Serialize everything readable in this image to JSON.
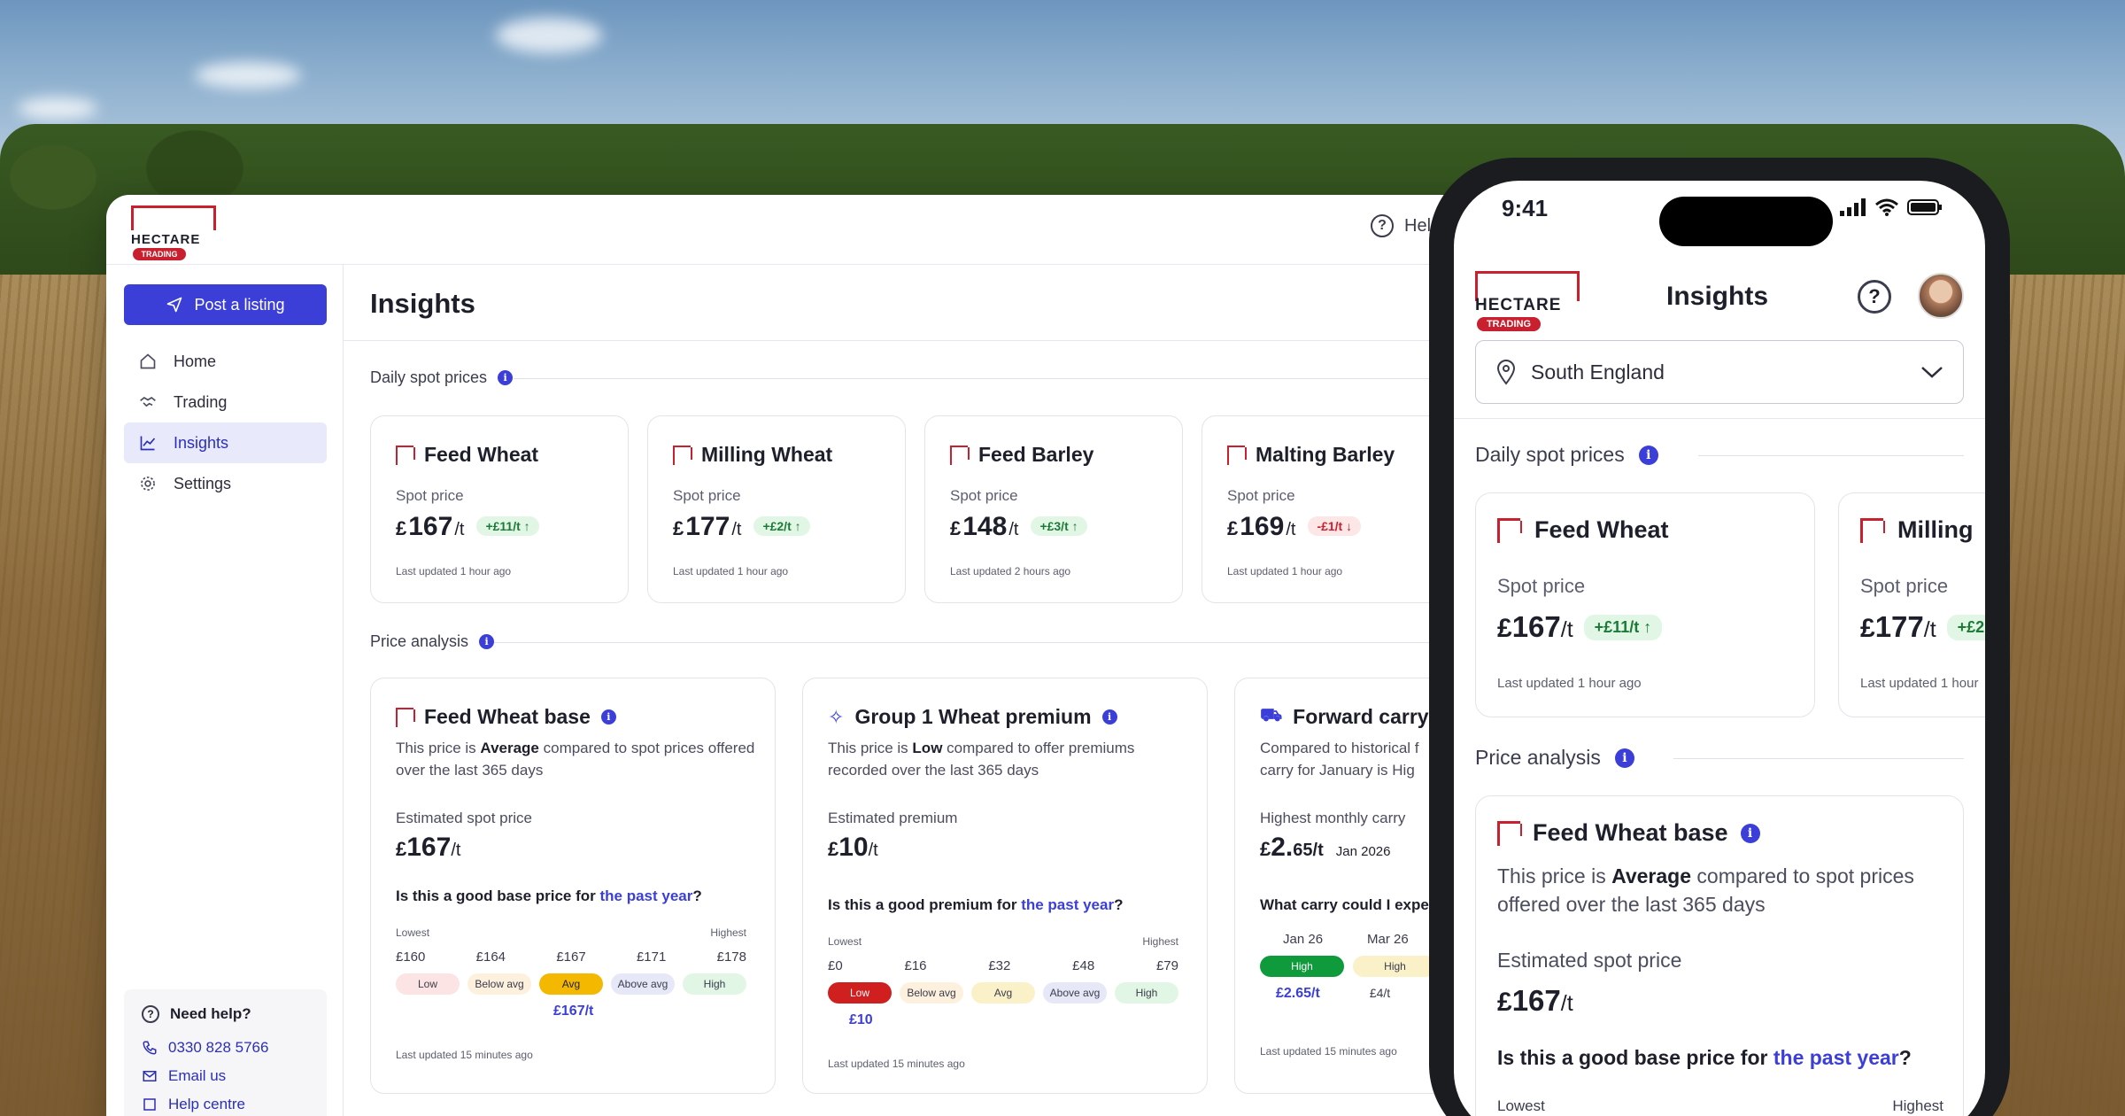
{
  "brand": {
    "word": "HECTARE",
    "tag": "TRADING"
  },
  "desktop": {
    "help_label": "Help",
    "post_button": "Post a listing",
    "nav": [
      {
        "label": "Home",
        "icon": "home-icon"
      },
      {
        "label": "Trading",
        "icon": "handshake-icon"
      },
      {
        "label": "Insights",
        "icon": "chart-icon",
        "active": true
      },
      {
        "label": "Settings",
        "icon": "gear-icon"
      }
    ],
    "help_box": {
      "title": "Need help?",
      "phone": "0330 828 5766",
      "email": "Email us",
      "centre": "Help centre"
    },
    "page_title": "Insights",
    "daily_label": "Daily spot prices",
    "analysis_label": "Price analysis",
    "spot_cards": [
      {
        "name": "Feed Wheat",
        "label": "Spot price",
        "currency": "£",
        "value": "167",
        "unit": "/t",
        "change": "+£11/t ↑",
        "direction": "up",
        "updated": "Last updated 1 hour ago"
      },
      {
        "name": "Milling Wheat",
        "label": "Spot price",
        "currency": "£",
        "value": "177",
        "unit": "/t",
        "change": "+£2/t ↑",
        "direction": "up",
        "updated": "Last updated 1 hour ago"
      },
      {
        "name": "Feed Barley",
        "label": "Spot price",
        "currency": "£",
        "value": "148",
        "unit": "/t",
        "change": "+£3/t ↑",
        "direction": "up",
        "updated": "Last updated 2 hours ago"
      },
      {
        "name": "Malting Barley",
        "label": "Spot price",
        "currency": "£",
        "value": "169",
        "unit": "/t",
        "change": "-£1/t ↓",
        "direction": "down",
        "updated": "Last updated 1 hour ago"
      }
    ],
    "analysis_cards": [
      {
        "title": "Feed Wheat base",
        "desc_pre": "This price is ",
        "desc_bold": "Average",
        "desc_post": " compared to spot prices offered over the last 365 days",
        "est_label": "Estimated spot price",
        "est_cur": "£",
        "est_value": "167",
        "est_unit": "/t",
        "question_pre": "Is this a good base price for ",
        "question_link": "the past year",
        "question_post": "?",
        "lowest": "Lowest",
        "highest": "Highest",
        "ticks": [
          "£160",
          "£164",
          "£167",
          "£171",
          "£178"
        ],
        "bands": [
          "Low",
          "Below avg",
          "Avg",
          "Above avg",
          "High"
        ],
        "active_band": 2,
        "marker": "£167/t",
        "updated": "Last updated 15 minutes ago"
      },
      {
        "title": "Group 1 Wheat premium",
        "desc_pre": "This price is ",
        "desc_bold": "Low",
        "desc_post": " compared to offer premiums recorded over the last 365 days",
        "est_label": "Estimated premium",
        "est_cur": "£",
        "est_value": "10",
        "est_unit": "/t",
        "question_pre": "Is this a good premium for ",
        "question_link": "the past year",
        "question_post": "?",
        "lowest": "Lowest",
        "highest": "Highest",
        "ticks": [
          "£0",
          "£16",
          "£32",
          "£48",
          "£79"
        ],
        "bands": [
          "Low",
          "Below avg",
          "Avg",
          "Above avg",
          "High"
        ],
        "active_band": 0,
        "marker": "£10",
        "updated": "Last updated 15 minutes ago"
      },
      {
        "title": "Forward carry",
        "desc_pre": "Compared to historical f",
        "desc_bold": "",
        "desc_post": "carry for January is Hig",
        "est_label": "Highest monthly carry",
        "est_cur": "£",
        "est_value": "2.",
        "est_unit": "65/t",
        "est_date": "Jan 2026",
        "question_pre": "What carry could I expe",
        "question_link": "",
        "question_post": "",
        "months": [
          "Jan 26",
          "Mar 26"
        ],
        "month_bands": [
          "High",
          "High"
        ],
        "month_values": [
          "£2.65/t",
          "£4/t"
        ],
        "updated": "Last updated 15 minutes ago"
      }
    ]
  },
  "phone": {
    "time": "9:41",
    "title": "Insights",
    "region": "South England",
    "daily_label": "Daily spot prices",
    "analysis_label": "Price analysis",
    "spot_cards": [
      {
        "name": "Feed Wheat",
        "label": "Spot price",
        "currency": "£",
        "value": "167",
        "unit": "/t",
        "change": "+£11/t ↑",
        "updated": "Last updated 1 hour ago"
      },
      {
        "name": "Milling",
        "label": "Spot price",
        "currency": "£",
        "value": "177",
        "unit": "/t",
        "change": "+£2",
        "updated": "Last updated 1 hour"
      }
    ],
    "analysis": {
      "title": "Feed Wheat base",
      "desc_pre": "This price is ",
      "desc_bold": "Average",
      "desc_post": " compared to spot prices offered over the last 365 days",
      "est_label": "Estimated spot price",
      "est_cur": "£",
      "est_value": "167",
      "est_unit": "/t",
      "question_pre": "Is this a good base price for ",
      "question_link": "the past year",
      "question_post": "?",
      "lowest": "Lowest",
      "highest": "Highest"
    }
  },
  "colors": {
    "accent": "#3b3fd8",
    "brand_red": "#c8202f",
    "band_low": "#fde4e4",
    "band_below": "#fdf0dd",
    "band_avg": "#fbf1c8",
    "band_above": "#e6e8f8",
    "band_high": "#e2f6e6",
    "band_active_avg": "#f5b800",
    "band_active_low": "#d01f1f",
    "band_active_high": "#0f9a3c"
  }
}
